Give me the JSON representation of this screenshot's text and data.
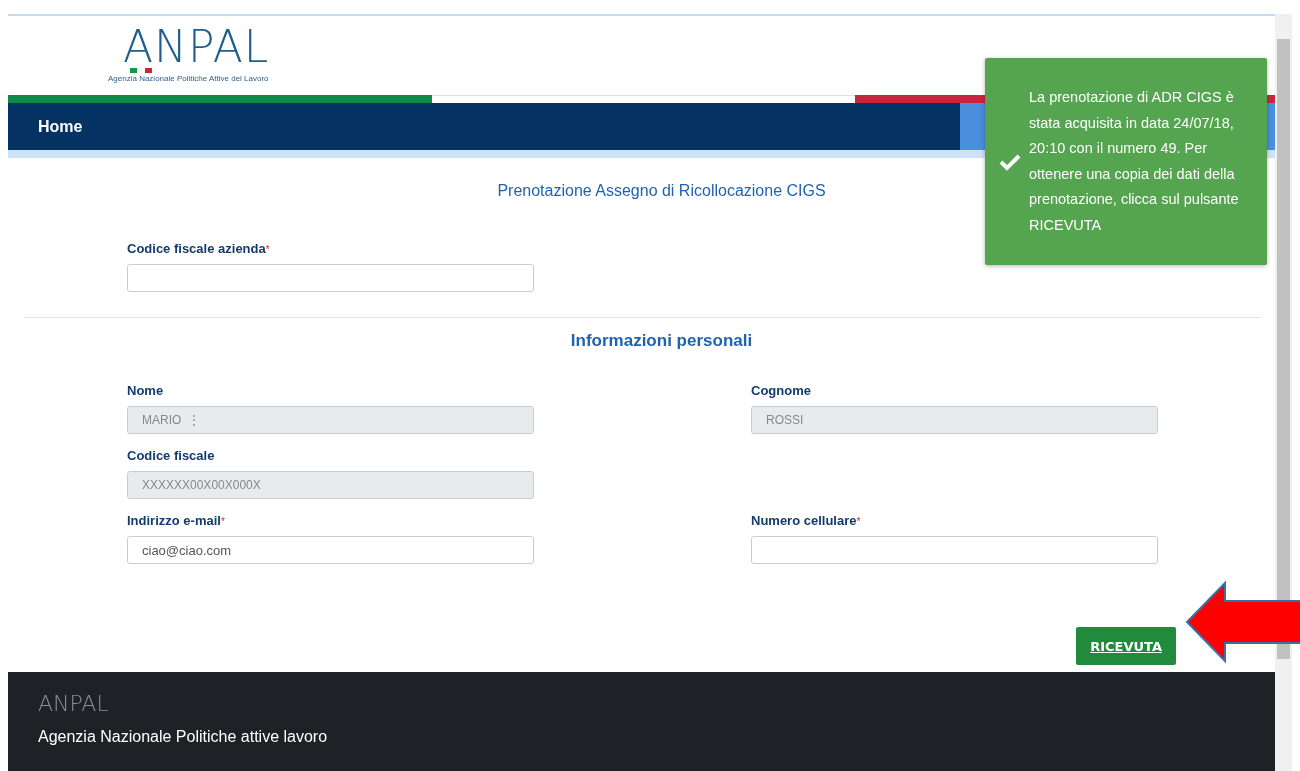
{
  "header": {
    "logo": "ANPAL",
    "logo_tagline": "Agenzia Nazionale Politiche Attive del Lavoro"
  },
  "nav": {
    "items": [
      {
        "label": "Home",
        "selected": false
      }
    ]
  },
  "form": {
    "title": "Prenotazione Assegno di Ricollocazione CIGS",
    "company_field": {
      "label": "Codice fiscale azienda",
      "required_mark": "*",
      "disabled": false
    },
    "section_title": "Informazioni personali",
    "fields": [
      {
        "label": "Nome",
        "value": "MARIO  ⋮",
        "disabled": true
      },
      {
        "label": "Cognome",
        "value": "ROSSI",
        "disabled": true
      },
      {
        "label": "Codice fiscale",
        "value": "XXXXXX00X00X000X",
        "disabled": true
      },
      {
        "label": "Indirizzo e-mail",
        "required_mark": "*",
        "value": "ciao@ciao.com",
        "disabled": false
      },
      {
        "label": "Numero cellulare",
        "required_mark": "*",
        "disabled": false
      }
    ],
    "button": "RICEVUTA"
  },
  "toast": {
    "message": "La prenotazione di ADR CIGS è stata acquisita in data 24/07/18, 20:10 con il numero 49. Per ottenere una copia dei dati della prenotazione, clicca sul pulsante RICEVUTA"
  },
  "footer": {
    "logo": "ANPAL",
    "text": "Agenzia Nazionale Politiche attive lavoro"
  }
}
